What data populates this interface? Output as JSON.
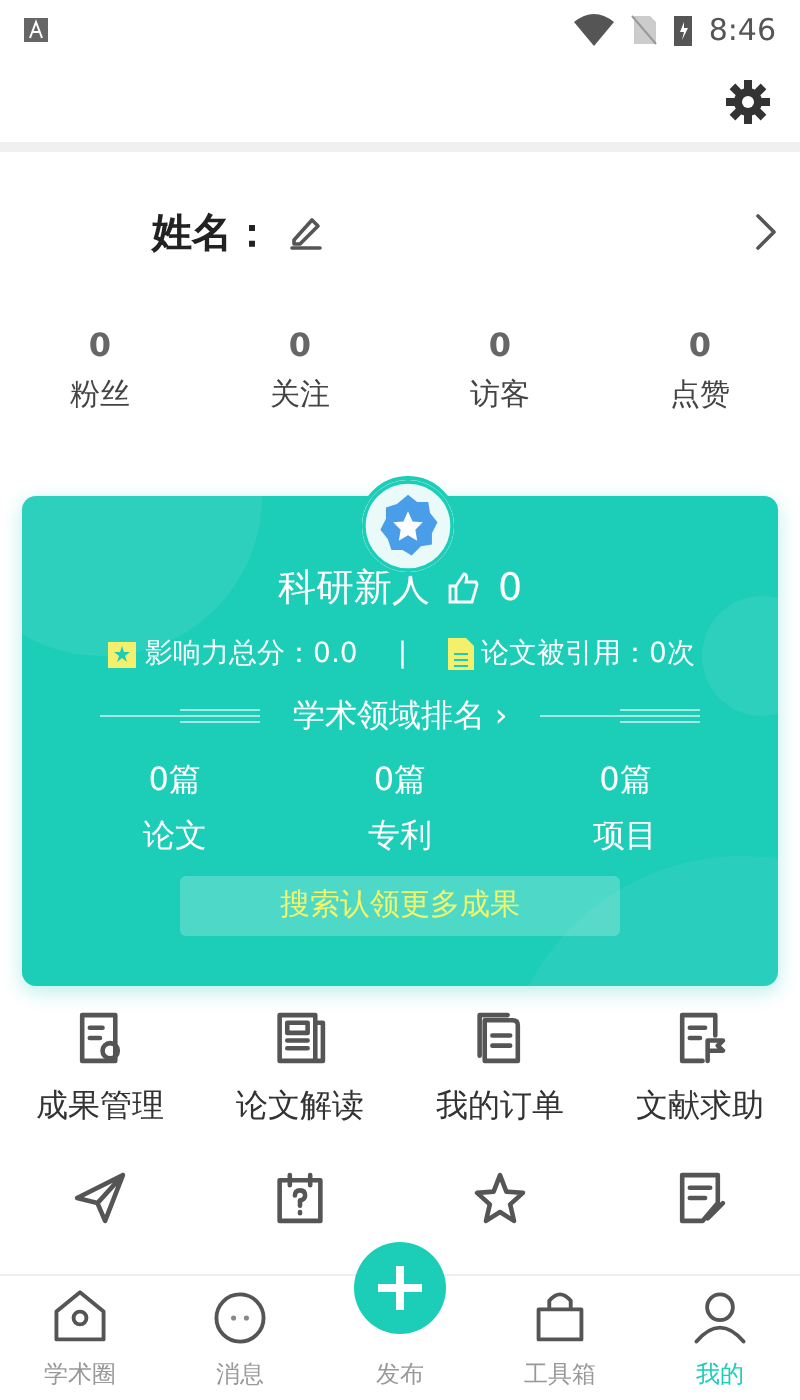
{
  "status_bar": {
    "time": "8:46"
  },
  "profile": {
    "name_label": "姓名："
  },
  "stats": [
    {
      "value": "0",
      "label": "粉丝"
    },
    {
      "value": "0",
      "label": "关注"
    },
    {
      "value": "0",
      "label": "访客"
    },
    {
      "value": "0",
      "label": "点赞"
    }
  ],
  "card": {
    "title": "科研新人",
    "likes": "0",
    "impact": "影响力总分：0.0",
    "separator": "|",
    "citations": "论文被引用：0次",
    "ranking": "学术领域排名",
    "ranking_arrow": "›",
    "counts": [
      {
        "value": "0篇",
        "label": "论文"
      },
      {
        "value": "0篇",
        "label": "专利"
      },
      {
        "value": "0篇",
        "label": "项目"
      }
    ],
    "button": "搜索认领更多成果"
  },
  "menu": [
    {
      "kind": "certificate",
      "label": "成果管理"
    },
    {
      "kind": "newspaper",
      "label": "论文解读"
    },
    {
      "kind": "document",
      "label": "我的订单"
    },
    {
      "kind": "flag",
      "label": "文献求助"
    },
    {
      "kind": "plane"
    },
    {
      "kind": "calendar"
    },
    {
      "kind": "star"
    },
    {
      "kind": "note"
    }
  ],
  "bottom_nav": [
    {
      "kind": "home",
      "label": "学术圈",
      "selected": false
    },
    {
      "kind": "chat",
      "label": "消息",
      "selected": false
    },
    {
      "kind": "fab",
      "label": "发布",
      "selected": false
    },
    {
      "kind": "bag",
      "label": "工具箱",
      "selected": false
    },
    {
      "kind": "person",
      "label": "我的",
      "selected": true
    }
  ]
}
